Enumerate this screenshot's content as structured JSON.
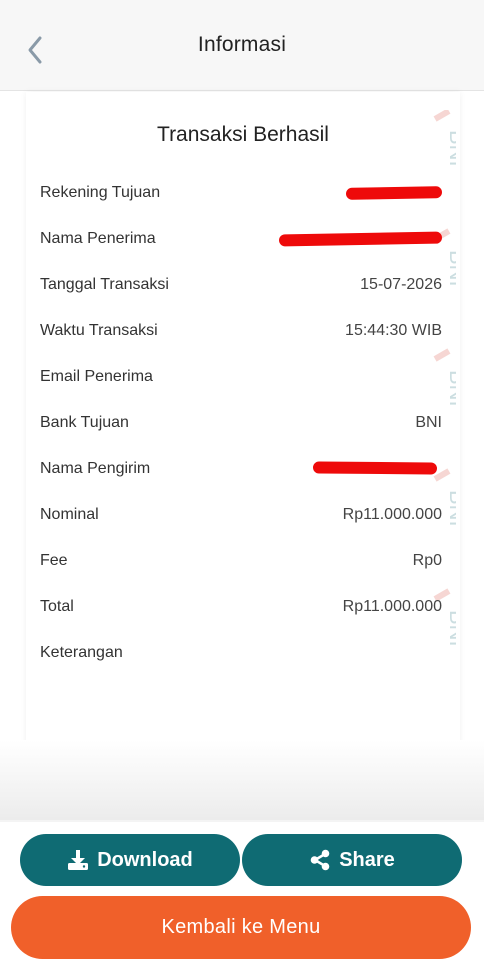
{
  "header": {
    "title": "Informasi",
    "back_icon": "chevron-left-icon"
  },
  "receipt": {
    "title": "Transaksi Berhasil",
    "watermark": "BNI",
    "rows": [
      {
        "label": "Rekening Tujuan",
        "value": ""
      },
      {
        "label": "Nama Penerima",
        "value": ""
      },
      {
        "label": "Tanggal Transaksi",
        "value": "15-07-2026"
      },
      {
        "label": "Waktu Transaksi",
        "value": "15:44:30 WIB"
      },
      {
        "label": "Email Penerima",
        "value": ""
      },
      {
        "label": "Bank Tujuan",
        "value": "BNI"
      },
      {
        "label": "Nama Pengirim",
        "value": ""
      },
      {
        "label": "Nominal",
        "value": "Rp11.000.000"
      },
      {
        "label": "Fee",
        "value": "Rp0"
      },
      {
        "label": "Total",
        "value": "Rp11.000.000"
      },
      {
        "label": "Keterangan",
        "value": ""
      }
    ]
  },
  "actions": {
    "download_label": "Download",
    "share_label": "Share",
    "back_to_menu_label": "Kembali ke Menu"
  },
  "colors": {
    "teal": "#0f6b73",
    "orange": "#f0602a",
    "redaction": "#ee0a0a"
  }
}
